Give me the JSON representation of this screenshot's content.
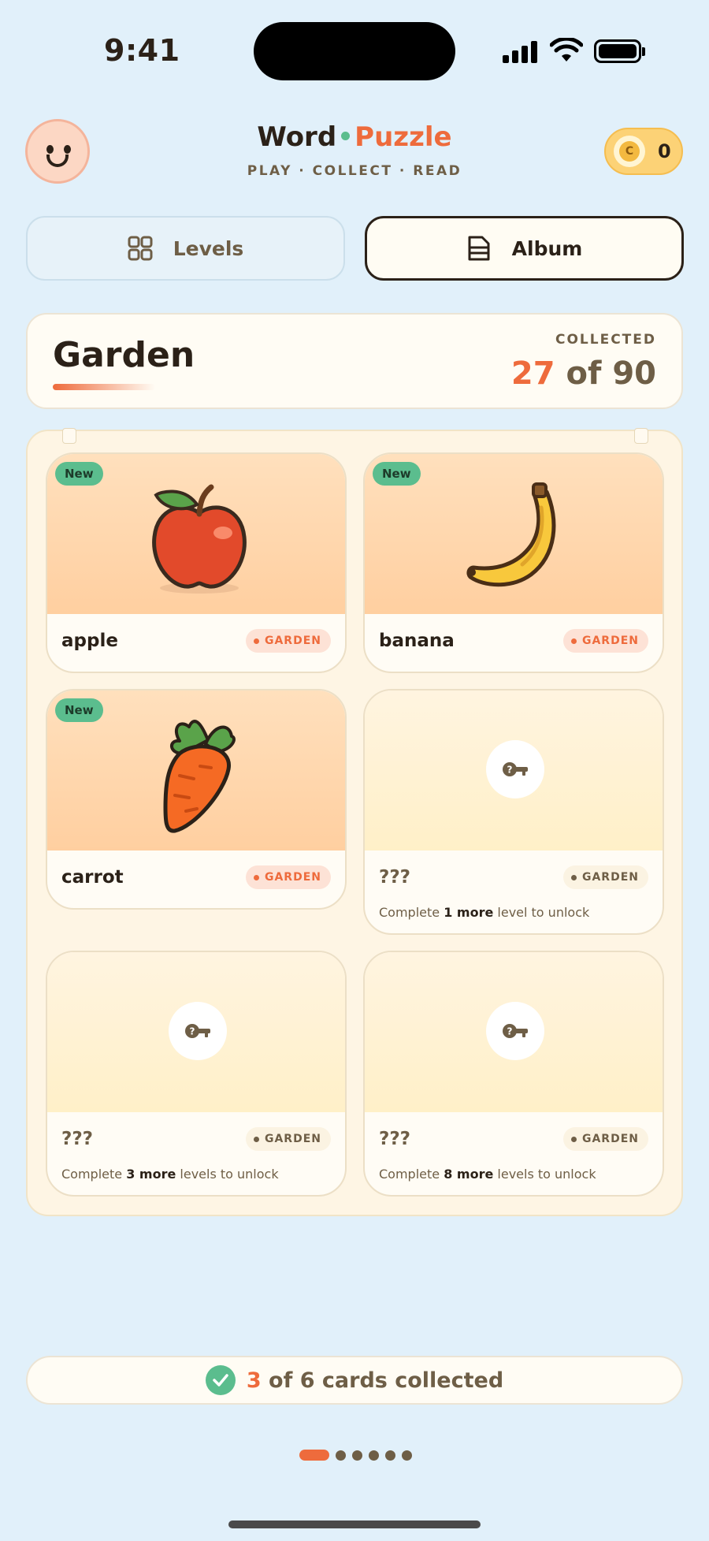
{
  "status_bar": {
    "time": "9:41"
  },
  "header": {
    "brand_word1": "Word",
    "brand_word2": "Puzzle",
    "tagline": "PLAY · COLLECT · READ",
    "coins": "0",
    "avatar_icon": "smiley-face-icon",
    "coin_icon": "coin-icon"
  },
  "tabs": [
    {
      "label": "Levels",
      "icon": "grid-icon",
      "active": false
    },
    {
      "label": "Album",
      "icon": "document-icon",
      "active": true
    }
  ],
  "collection": {
    "title": "Garden",
    "label": "COLLECTED",
    "collected": "27",
    "of_text": "of 90"
  },
  "cards": [
    {
      "word": "apple",
      "tag": "GARDEN",
      "badge": "New",
      "image": "apple-icon"
    },
    {
      "word": "banana",
      "tag": "GARDEN",
      "badge": "New",
      "image": "banana-icon"
    },
    {
      "word": "carrot",
      "tag": "GARDEN",
      "badge": "New",
      "image": "carrot-icon"
    },
    {
      "word": "???",
      "tag": "GARDEN",
      "image": "lock-key-icon",
      "hint_pre": "Complete ",
      "hint_bold": "1 more",
      "hint_post": " level to unlock"
    },
    {
      "word": "???",
      "tag": "GARDEN",
      "image": "lock-key-icon",
      "hint_pre": "Complete ",
      "hint_bold": "3 more",
      "hint_post": " levels to unlock"
    },
    {
      "word": "???",
      "tag": "GARDEN",
      "image": "lock-key-icon",
      "hint_pre": "Complete ",
      "hint_bold": "8 more",
      "hint_post": " levels to unlock"
    }
  ],
  "footer": {
    "count": "3",
    "text": "of 6 cards collected"
  },
  "pagination": {
    "pages": 6,
    "current": 1
  },
  "colors": {
    "background": "#e1f0fa",
    "accent": "#ee6b3c",
    "success": "#5bbd8e",
    "ink": "#2b2118",
    "muted": "#6e5e46"
  }
}
